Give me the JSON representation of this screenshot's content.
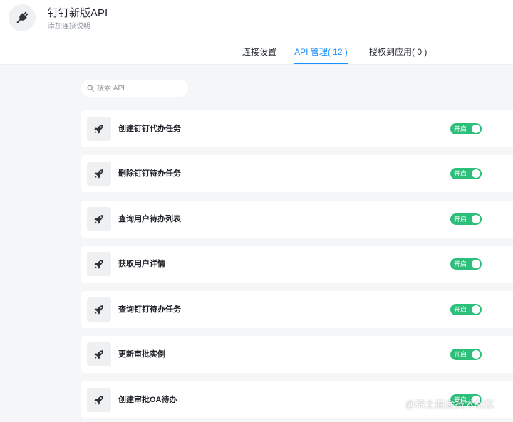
{
  "app": {
    "title": "钉钉新版API",
    "subtitle": "添加连接说明",
    "icon": "plug-icon"
  },
  "tabs": [
    {
      "label": "连接设置",
      "active": false
    },
    {
      "label": "API 管理( 12 )",
      "active": true
    },
    {
      "label": "授权到应用( 0 )",
      "active": false
    }
  ],
  "search": {
    "placeholder": "搜索 API",
    "value": ""
  },
  "toggle_label": "开启",
  "apis": [
    {
      "name": "创建钉钉代办任务",
      "enabled": true,
      "icon": "rocket-icon"
    },
    {
      "name": "删除钉钉待办任务",
      "enabled": true,
      "icon": "rocket-icon"
    },
    {
      "name": "查询用户待办列表",
      "enabled": true,
      "icon": "rocket-icon"
    },
    {
      "name": "获取用户详情",
      "enabled": true,
      "icon": "rocket-icon"
    },
    {
      "name": "查询钉钉待办任务",
      "enabled": true,
      "icon": "rocket-icon"
    },
    {
      "name": "更新审批实例",
      "enabled": true,
      "icon": "rocket-icon"
    },
    {
      "name": "创建审批OA待办",
      "enabled": true,
      "icon": "rocket-icon"
    }
  ],
  "colors": {
    "accent": "#1890ff",
    "toggle_on": "#2bbf7a",
    "background": "#f5f6f7"
  },
  "watermark": "@稀土掘金技术社区"
}
